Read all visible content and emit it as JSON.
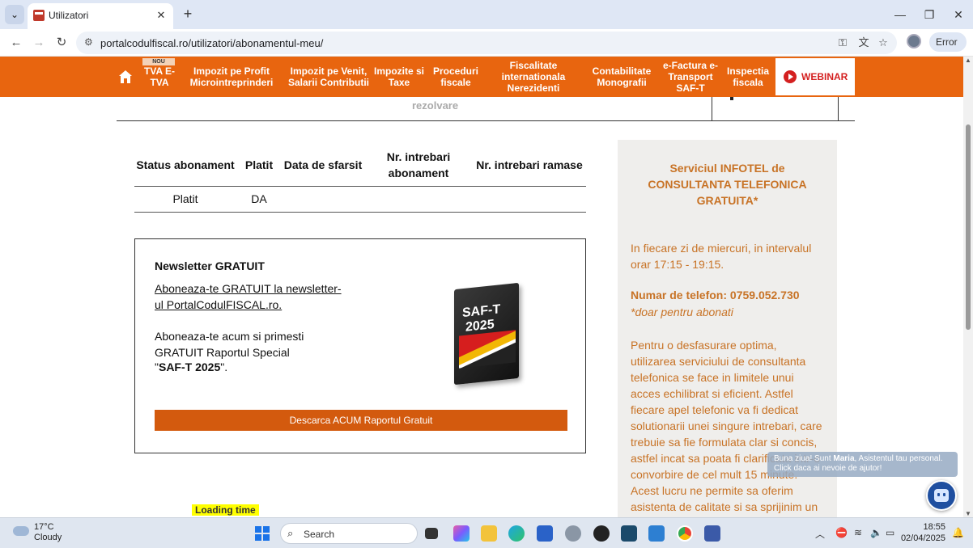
{
  "browser": {
    "tab_title": "Utilizatori",
    "url": "portalcodulfiscal.ro/utilizatori/abonamentul-meu/",
    "profile_status": "Error"
  },
  "site_nav": {
    "badge": "NOU",
    "items": [
      "TVA E-TVA",
      "Impozit pe Profit Microintreprinderi",
      "Impozit pe Venit, Salarii Contributii",
      "Impozite si Taxe",
      "Proceduri fiscale",
      "Fiscalitate internationala Nerezidenti",
      "Contabilitate Monografii",
      "e-Factura e-Transport SAF-T",
      "Inspectia fiscala"
    ],
    "webinar_label": "WEBINAR"
  },
  "partial_row": {
    "text": "rezolvare"
  },
  "subscription_table": {
    "headers": [
      "Status abonament",
      "Platit",
      "Data de sfarsit",
      "Nr. intrebari abonament",
      "Nr. intrebari ramase"
    ],
    "rows": [
      [
        "Platit",
        "DA",
        "",
        "",
        ""
      ]
    ]
  },
  "newsletter": {
    "title": "Newsletter GRATUIT",
    "link": "Aboneaza-te GRATUIT la newsletter-ul PortalCodulFISCAL.ro.",
    "description": "Aboneaza-te acum si primesti GRATUIT Raportul Special",
    "report_name": "SAF-T 2025",
    "report_quote_open": "\"",
    "report_quote_close": "\".",
    "book_title": "SAF-T",
    "book_year": "2025",
    "button": "Descarca ACUM Raportul Gratuit"
  },
  "loading_time": "Loading time",
  "sidebar": {
    "title": "Serviciul INFOTEL de CONSULTANTA TELEFONICA GRATUITA*",
    "schedule": "In fiecare zi de miercuri, in intervalul orar 17:15 - 19:15.",
    "phone": "Numar de telefon: 0759.052.730",
    "note": "*doar pentru abonati",
    "body": "Pentru o desfasurare optima, utilizarea serviciului de consultanta telefonica se face in limitele unui acces echilibrat si eficient. Astfel fiecare apel telefonic va fi dedicat solutionarii unei singure intrebari, care trebuie sa fie formulata clar si concis, astfel incat sa poata fi clarificata intr-o convorbire de cel mult 15 minute. Acest lucru ne permite sa oferim asistenta de calitate si sa sprijinim un numar cat mai mare de clienti in solutionarea rapida a"
  },
  "chat": {
    "greeting_pre": "Buna ziua! Sunt ",
    "assistant_name": "Maria",
    "greeting_post": ", Asistentul tau personal.",
    "cta": "Click daca ai nevoie de ajutor!"
  },
  "taskbar": {
    "temperature": "17°C",
    "condition": "Cloudy",
    "search_label": "Search",
    "time": "18:55",
    "date": "02/04/2025"
  },
  "colors": {
    "brand_orange": "#e8650f",
    "button_orange": "#d35a0e",
    "sidebar_text": "#c87326",
    "webinar_red": "#d42020"
  }
}
